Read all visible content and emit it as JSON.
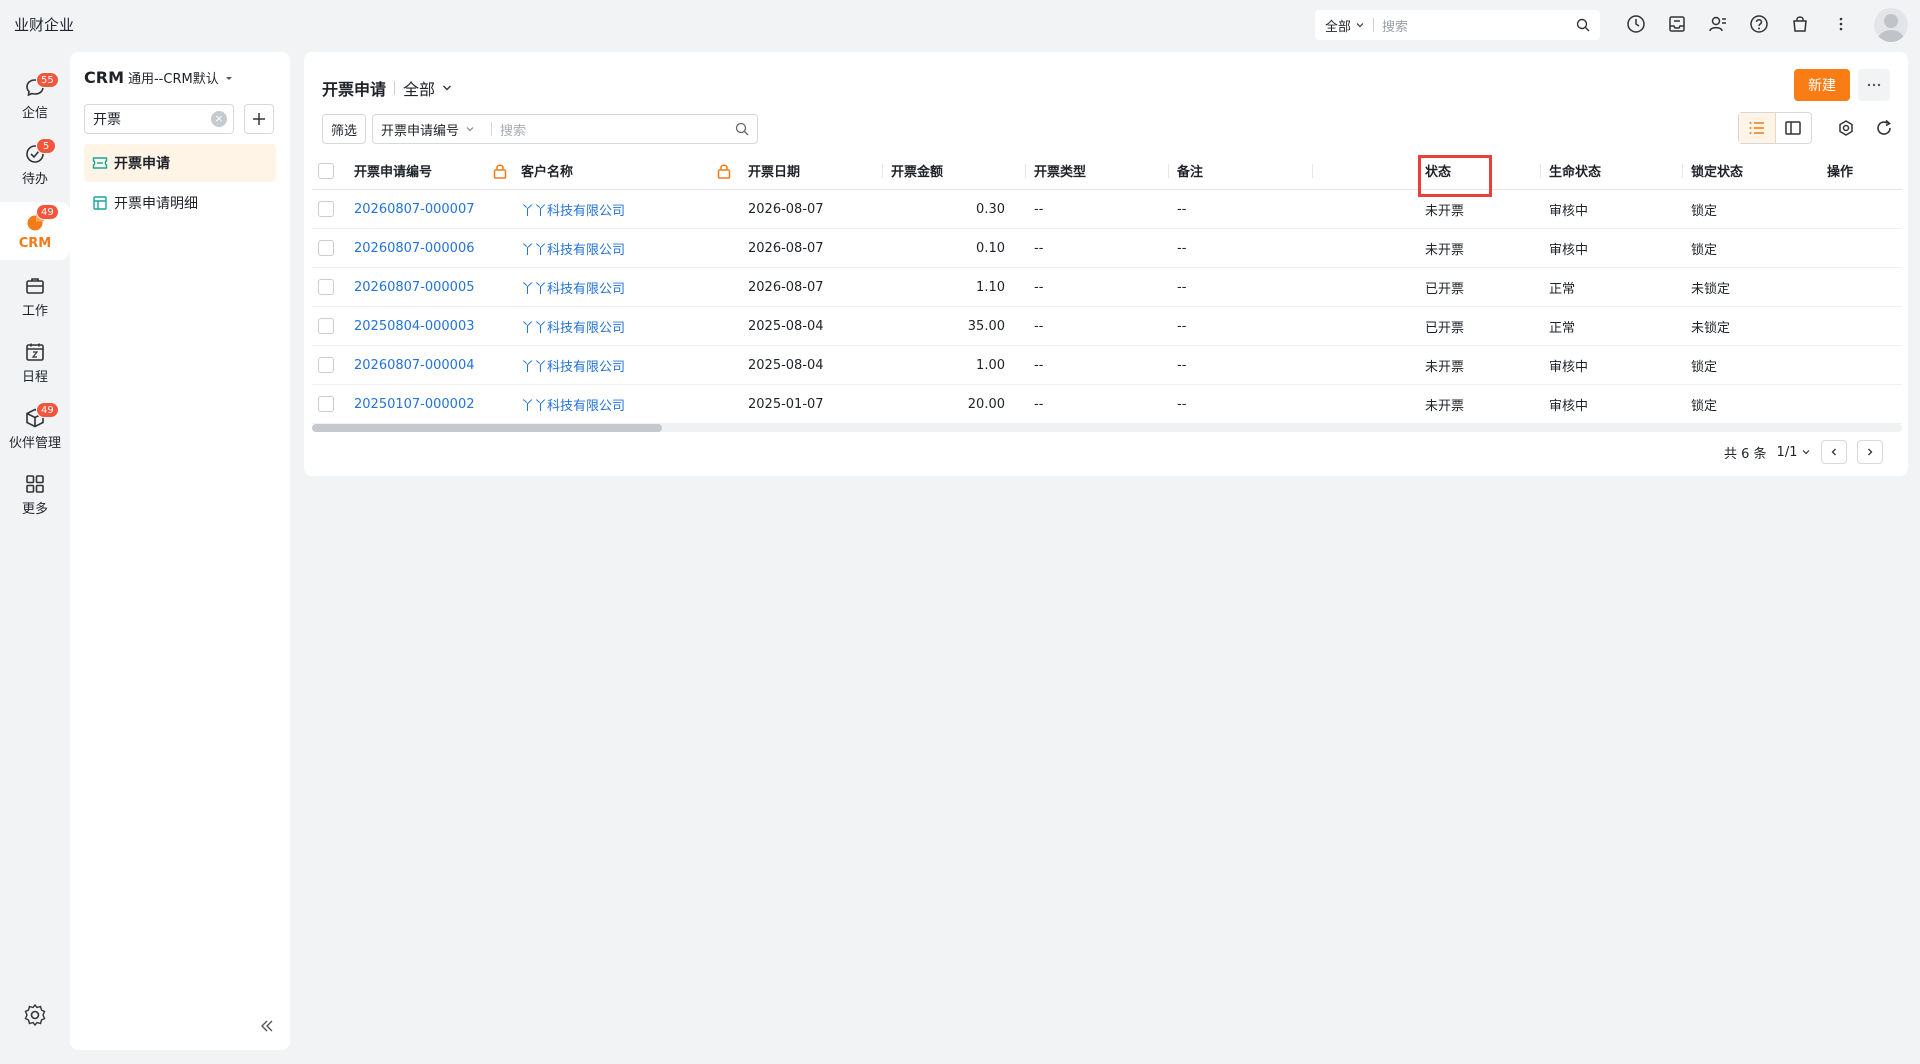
{
  "app": {
    "company": "业财企业"
  },
  "global_search": {
    "scope": "全部",
    "placeholder": "搜索"
  },
  "rail": [
    {
      "label": "企信",
      "badge": "55",
      "icon": "chat-icon",
      "active": false
    },
    {
      "label": "待办",
      "badge": "5",
      "icon": "todo-check-icon",
      "active": false
    },
    {
      "label": "CRM",
      "badge": "49",
      "icon": "crm-pie-icon",
      "active": true
    },
    {
      "label": "工作",
      "badge": "",
      "icon": "briefcase-icon",
      "active": false
    },
    {
      "label": "日程",
      "badge": "",
      "icon": "calendar-icon",
      "active": false
    },
    {
      "label": "伙伴管理",
      "badge": "49",
      "icon": "partner-box-icon",
      "active": false
    },
    {
      "label": "更多",
      "badge": "",
      "icon": "grid-icon",
      "active": false
    }
  ],
  "nav2": {
    "title": "CRM",
    "subtitle": "通用--CRM默认",
    "search_value": "开票",
    "items": [
      {
        "label": "开票申请",
        "active": true
      },
      {
        "label": "开票申请明细",
        "active": false
      }
    ]
  },
  "main": {
    "title": "开票申请",
    "view": "全部",
    "new_button": "新建",
    "filter_button": "筛选",
    "search_field": "开票申请编号",
    "search_placeholder": "搜索"
  },
  "table": {
    "headers": [
      "开票申请编号",
      "客户名称",
      "开票日期",
      "开票金额",
      "开票类型",
      "备注",
      "状态",
      "生命状态",
      "锁定状态",
      "操作"
    ],
    "rows": [
      {
        "id": "20260807-000007",
        "customer": "丫丫科技有限公司",
        "date": "2026-08-07",
        "amount": "0.30",
        "type": "--",
        "note": "--",
        "status": "未开票",
        "life": "审核中",
        "lock": "锁定"
      },
      {
        "id": "20260807-000006",
        "customer": "丫丫科技有限公司",
        "date": "2026-08-07",
        "amount": "0.10",
        "type": "--",
        "note": "--",
        "status": "未开票",
        "life": "审核中",
        "lock": "锁定"
      },
      {
        "id": "20260807-000005",
        "customer": "丫丫科技有限公司",
        "date": "2026-08-07",
        "amount": "1.10",
        "type": "--",
        "note": "--",
        "status": "已开票",
        "life": "正常",
        "lock": "未锁定"
      },
      {
        "id": "20250804-000003",
        "customer": "丫丫科技有限公司",
        "date": "2025-08-04",
        "amount": "35.00",
        "type": "--",
        "note": "--",
        "status": "已开票",
        "life": "正常",
        "lock": "未锁定"
      },
      {
        "id": "20260807-000004",
        "customer": "丫丫科技有限公司",
        "date": "2025-08-04",
        "amount": "1.00",
        "type": "--",
        "note": "--",
        "status": "未开票",
        "life": "审核中",
        "lock": "锁定"
      },
      {
        "id": "20250107-000002",
        "customer": "丫丫科技有限公司",
        "date": "2025-01-07",
        "amount": "20.00",
        "type": "--",
        "note": "--",
        "status": "未开票",
        "life": "审核中",
        "lock": "锁定"
      }
    ]
  },
  "pager": {
    "total": "共 6 条",
    "page": "1/1"
  },
  "colors": {
    "accent": "#f97c14",
    "link": "#2373d8",
    "badge": "#f4553b",
    "highlight": "#e8413a"
  }
}
